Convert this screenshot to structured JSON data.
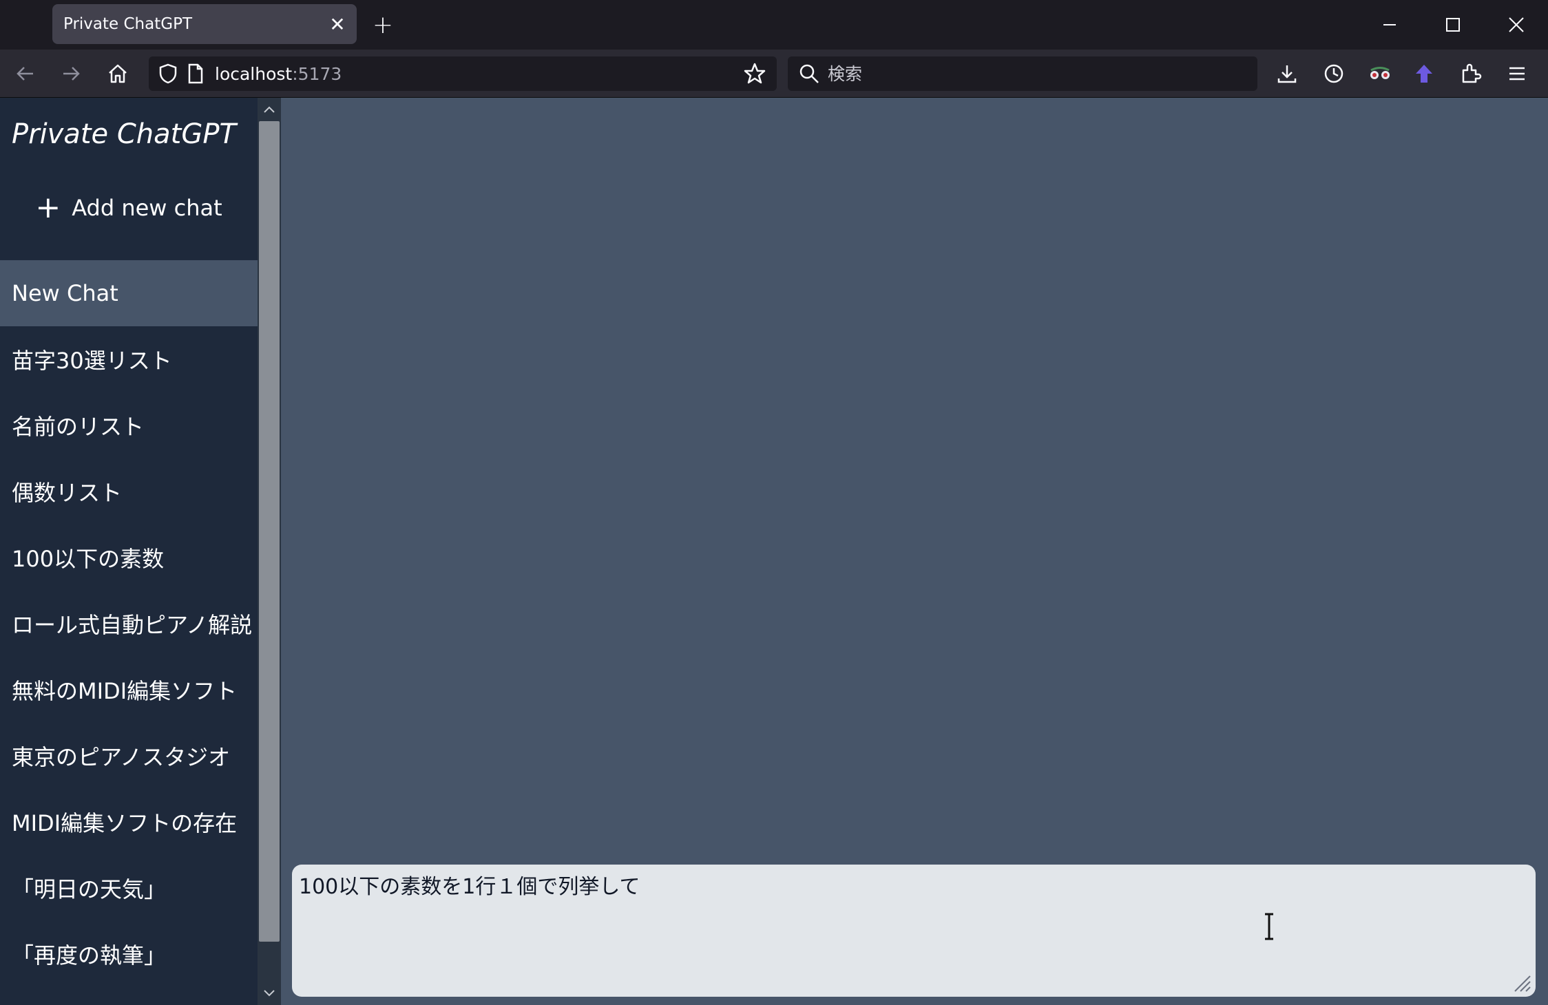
{
  "browser": {
    "tab_title": "Private ChatGPT",
    "url_host": "localhost",
    "url_port": ":5173",
    "search_placeholder": "検索"
  },
  "sidebar": {
    "brand": "Private ChatGPT",
    "add_chat_label": "Add new chat",
    "chats": [
      {
        "label": "New Chat",
        "active": true
      },
      {
        "label": "苗字30選リスト"
      },
      {
        "label": "名前のリスト"
      },
      {
        "label": "偶数リスト"
      },
      {
        "label": "100以下の素数"
      },
      {
        "label": "ロール式自動ピアノ解説"
      },
      {
        "label": "無料のMIDI編集ソフト"
      },
      {
        "label": "東京のピアノスタジオ"
      },
      {
        "label": "MIDI編集ソフトの存在"
      },
      {
        "label": "「明日の天気」"
      },
      {
        "label": "「再度の執筆」"
      }
    ]
  },
  "prompt": {
    "value": "100以下の素数を1行１個で列挙して"
  },
  "colors": {
    "sidebar_bg": "#1e293b",
    "main_bg": "#475569",
    "active_item_bg": "#475569",
    "prompt_bg": "#e2e6ea"
  }
}
